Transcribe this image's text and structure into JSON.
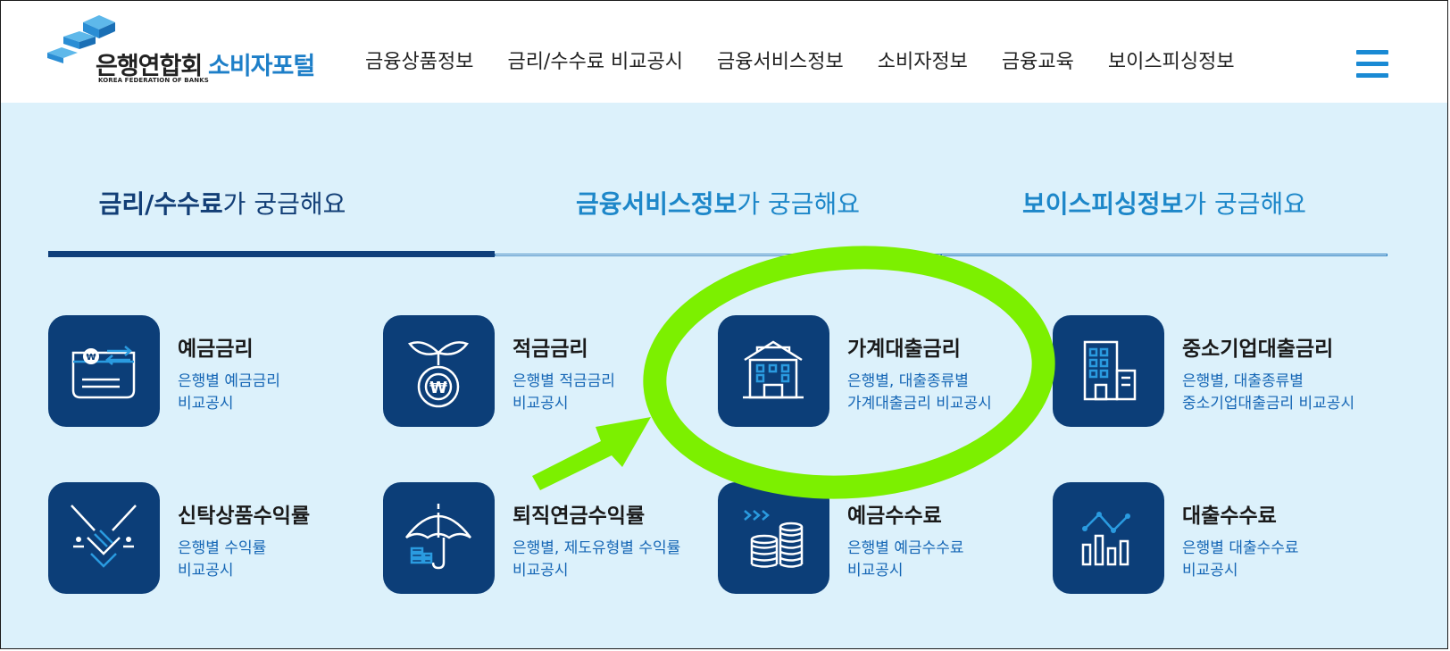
{
  "header": {
    "logo_main": "은행연합회",
    "logo_sub": "KOREA FEDERATION OF BANKS",
    "logo_portal": "소비자포털",
    "nav": [
      "금융상품정보",
      "금리/수수료 비교공시",
      "금융서비스정보",
      "소비자정보",
      "금융교육",
      "보이스피싱정보"
    ],
    "menu_icon": "hamburger-menu-icon"
  },
  "tabs": [
    {
      "strong": "금리/수수료",
      "rest": "가 궁금해요"
    },
    {
      "strong": "금융서비스정보",
      "rest": "가 궁금해요"
    },
    {
      "strong": "보이스피싱정보",
      "rest": "가 궁금해요"
    }
  ],
  "cards": [
    {
      "title": "예금금리",
      "desc1": "은행별 예금금리",
      "desc2": "비교공시",
      "icon": "deposit-card-icon"
    },
    {
      "title": "적금금리",
      "desc1": "은행별 적금금리",
      "desc2": "비교공시",
      "icon": "sprout-coin-icon"
    },
    {
      "title": "가계대출금리",
      "desc1": "은행별, 대출종류별",
      "desc2": "가계대출금리 비교공시",
      "icon": "house-icon"
    },
    {
      "title": "중소기업대출금리",
      "desc1": "은행별, 대출종류별",
      "desc2": "중소기업대출금리 비교공시",
      "icon": "building-icon"
    },
    {
      "title": "신탁상품수익률",
      "desc1": "은행별 수익률",
      "desc2": "비교공시",
      "icon": "handshake-icon"
    },
    {
      "title": "퇴직연금수익률",
      "desc1": "은행별, 제도유형별 수익률",
      "desc2": "비교공시",
      "icon": "umbrella-icon"
    },
    {
      "title": "예금수수료",
      "desc1": "은행별 예금수수료",
      "desc2": "비교공시",
      "icon": "coin-stack-icon"
    },
    {
      "title": "대출수수료",
      "desc1": "은행별 대출수수료",
      "desc2": "비교공시",
      "icon": "bar-chart-icon"
    }
  ],
  "colors": {
    "accent": "#1e7fc8",
    "navy": "#0c3e78",
    "background": "#dcf1fb",
    "highlight": "#7cf000"
  }
}
